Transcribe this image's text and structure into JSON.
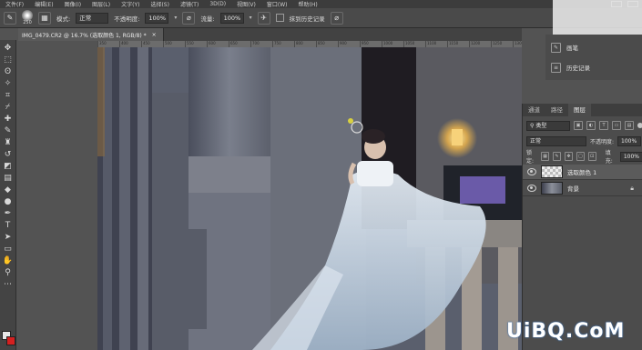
{
  "menubar": {
    "items": [
      "文件(F)",
      "编辑(E)",
      "图像(I)",
      "图层(L)",
      "文字(Y)",
      "选择(S)",
      "滤镜(T)",
      "3D(D)",
      "视图(V)",
      "窗口(W)",
      "帮助(H)"
    ]
  },
  "options": {
    "brush_size": "250",
    "mode_label": "模式:",
    "mode_value": "正常",
    "opacity_label": "不透明度:",
    "opacity_value": "100%",
    "flow_label": "流量:",
    "flow_value": "100%",
    "erase_history_label": "抹到历史记录"
  },
  "document": {
    "tab_title": "IMG_0479.CR2 @ 16.7% (选取颜色 1, RGB/8) *",
    "close_glyph": "×"
  },
  "ruler": {
    "ticks": [
      "350",
      "400",
      "450",
      "500",
      "550",
      "600",
      "650",
      "700",
      "750",
      "800",
      "850",
      "900",
      "950",
      "1000",
      "1050",
      "1100",
      "1150",
      "1200",
      "1250",
      "1300"
    ]
  },
  "history": {
    "items": [
      {
        "label": "画笔",
        "icon": "brush-icon"
      },
      {
        "label": "历史记录",
        "icon": "history-icon"
      }
    ]
  },
  "layers_panel": {
    "tabs": [
      "通道",
      "路径",
      "图层"
    ],
    "active_tab": "图层",
    "filter_label": "类型",
    "blend_mode": "正常",
    "opacity_label": "不透明度:",
    "opacity_value": "100%",
    "lock_label": "锁定:",
    "fill_label": "填充:",
    "fill_value": "100%",
    "layers": [
      {
        "name": "选取颜色 1",
        "selected": true
      },
      {
        "name": "背景",
        "selected": false
      }
    ]
  },
  "watermark": "UiBQ.CoM",
  "colors": {
    "foreground": "#e8e8e8",
    "background": "#d42020",
    "ui_dark": "#3c3c3c",
    "panel": "#4c4c4c"
  }
}
